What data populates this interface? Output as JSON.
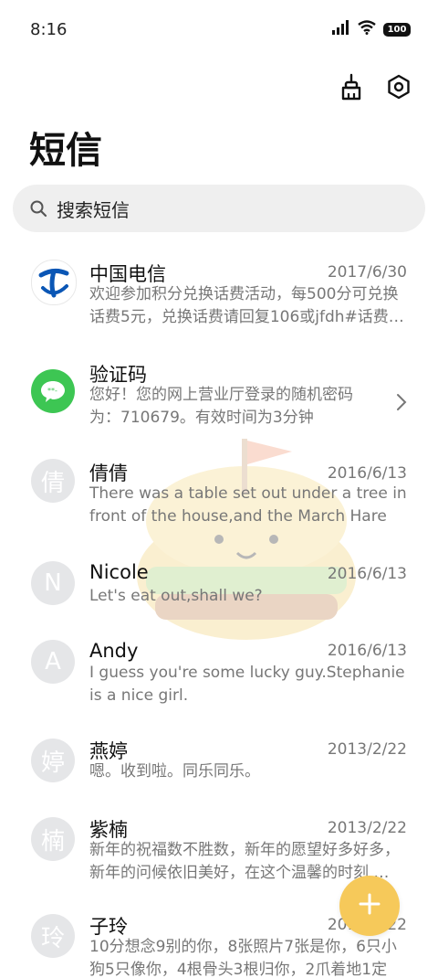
{
  "status": {
    "time": "8:16",
    "battery": "100"
  },
  "header": {
    "title": "短信"
  },
  "search": {
    "placeholder": "搜索短信"
  },
  "messages": [
    {
      "name": "中国电信",
      "date": "2017/6/30",
      "preview": "欢迎参加积分兑换话费活动，每500分可兑换话费5元，兑换话费请回复106或jfdh#话费…",
      "avatar": ""
    },
    {
      "name": "验证码",
      "date": "",
      "preview": "您好！您的网上营业厅登录的随机密码为：710679。有效时间为3分钟",
      "avatar": ""
    },
    {
      "name": "倩倩",
      "date": "2016/6/13",
      "preview": "There was a table set out under a tree in front of the house,and the March Hare an…",
      "avatar": "倩"
    },
    {
      "name": "Nicole",
      "date": "2016/6/13",
      "preview": "Let's eat out,shall we?",
      "avatar": "N"
    },
    {
      "name": "Andy",
      "date": "2016/6/13",
      "preview": "I guess you're some lucky guy.Stephanie is a nice girl.",
      "avatar": "A"
    },
    {
      "name": "燕婷",
      "date": "2013/2/22",
      "preview": "嗯。收到啦。同乐同乐。",
      "avatar": "婷"
    },
    {
      "name": "紫楠",
      "date": "2013/2/22",
      "preview": "新年的祝福数不胜数，新年的愿望好多好多，新年的问候依旧美好，在这个温馨的时刻 …",
      "avatar": "楠"
    },
    {
      "name": "子玲",
      "date": "2013/2/22",
      "preview": "10分想念9别的你，8张照片7张是你，6只小狗5只像你，4根骨头3根归你，2爪着地1定",
      "avatar": "玲"
    }
  ]
}
